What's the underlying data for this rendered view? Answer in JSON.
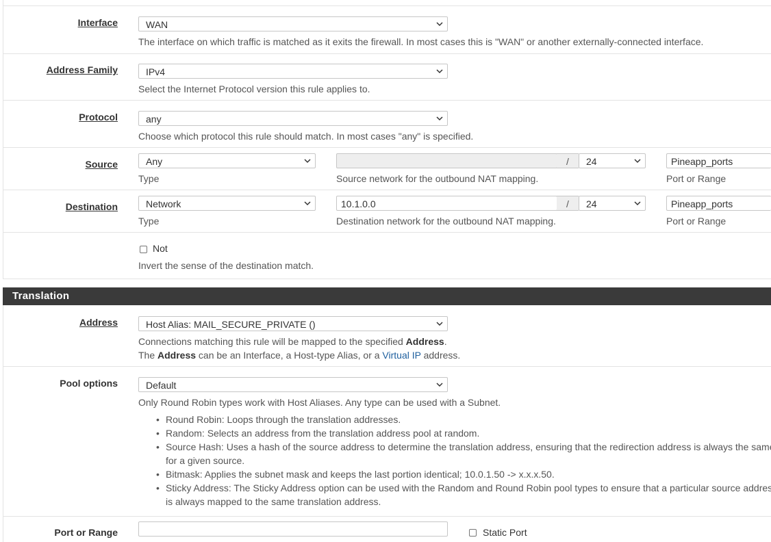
{
  "fields": {
    "interface": {
      "label": "Interface",
      "value": "WAN",
      "help": "The interface on which traffic is matched as it exits the firewall. In most cases this is \"WAN\" or another externally-connected interface."
    },
    "address_family": {
      "label": "Address Family",
      "value": "IPv4",
      "help": "Select the Internet Protocol version this rule applies to."
    },
    "protocol": {
      "label": "Protocol",
      "value": "any",
      "help": "Choose which protocol this rule should match. In most cases \"any\" is specified."
    },
    "source": {
      "label": "Source",
      "type_value": "Any",
      "type_help": "Type",
      "network_value": "",
      "slash": "/",
      "mask_value": "24",
      "network_help": "Source network for the outbound NAT mapping.",
      "port_value": "Pineapp_ports",
      "port_help": "Port or Range"
    },
    "destination": {
      "label": "Destination",
      "type_value": "Network",
      "type_help": "Type",
      "network_value": "10.1.0.0",
      "slash": "/",
      "mask_value": "24",
      "network_help": "Destination network for the outbound NAT mapping.",
      "port_value": "Pineapp_ports",
      "port_help": "Port or Range"
    },
    "not": {
      "checkbox_label": "Not",
      "checked": false,
      "help": "Invert the sense of the destination match."
    }
  },
  "translation": {
    "section_title": "Translation",
    "address": {
      "label": "Address",
      "value": "Host Alias: MAIL_SECURE_PRIVATE ()",
      "help_line1_pre": "Connections matching this rule will be mapped to the specified ",
      "help_line1_bold": "Address",
      "help_line1_post": ".",
      "help_line2_pre": "The ",
      "help_line2_bold": "Address",
      "help_line2_mid": " can be an Interface, a Host-type Alias, or a ",
      "help_line2_link": "Virtual IP",
      "help_line2_post": " address."
    },
    "pool_options": {
      "label": "Pool options",
      "value": "Default",
      "help": "Only Round Robin types work with Host Aliases. Any type can be used with a Subnet.",
      "items": [
        "Round Robin: Loops through the translation addresses.",
        "Random: Selects an address from the translation address pool at random.",
        "Source Hash: Uses a hash of the source address to determine the translation address, ensuring that the redirection address is always the same",
        "for a given source.",
        "Bitmask: Applies the subnet mask and keeps the last portion identical; 10.0.1.50 -> x.x.x.50.",
        "Sticky Address: The Sticky Address option can be used with the Random and Round Robin pool types to ensure that a particular source address",
        "is always mapped to the same translation address."
      ]
    },
    "port_or_range": {
      "label": "Port or Range",
      "value": "",
      "static_port_label": "Static Port",
      "static_port_checked": false
    }
  },
  "colors": {
    "section_bar": "#3a3a3a",
    "link": "#1e5f9e",
    "border": "#c6c6c6"
  }
}
